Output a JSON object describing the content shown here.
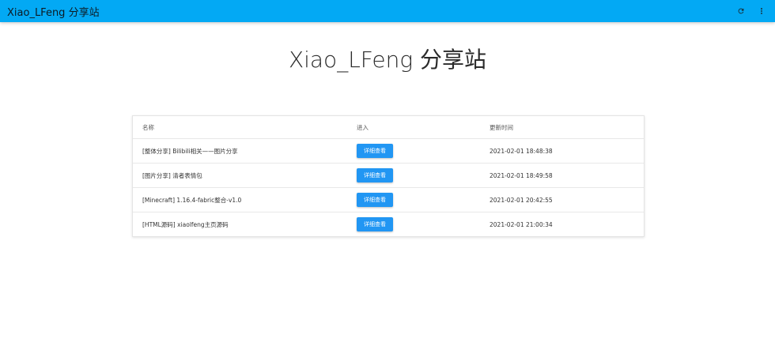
{
  "appbar": {
    "title": "Xiao_LFeng 分享站",
    "refresh_icon": "refresh-icon",
    "more_icon": "more-vert-icon",
    "background": "#03a9f4"
  },
  "page": {
    "title": "Xiao_LFeng 分享站"
  },
  "table": {
    "headers": [
      "名称",
      "进入",
      "更新时间"
    ],
    "rows": [
      {
        "name": "[整体分享] Bilibili相关——图片分享",
        "action": "详细查看",
        "updated": "2021-02-01 18:48:38"
      },
      {
        "name": "[图片分享] 清者表情包",
        "action": "详细查看",
        "updated": "2021-02-01 18:49:58"
      },
      {
        "name": "[Minecraft] 1.16.4-fabric整合-v1.0",
        "action": "详细查看",
        "updated": "2021-02-01 20:42:55"
      },
      {
        "name": "[HTML源码] xiaolfeng主页源码",
        "action": "详细查看",
        "updated": "2021-02-01 21:00:34"
      }
    ],
    "button_color": "#2196f3"
  }
}
